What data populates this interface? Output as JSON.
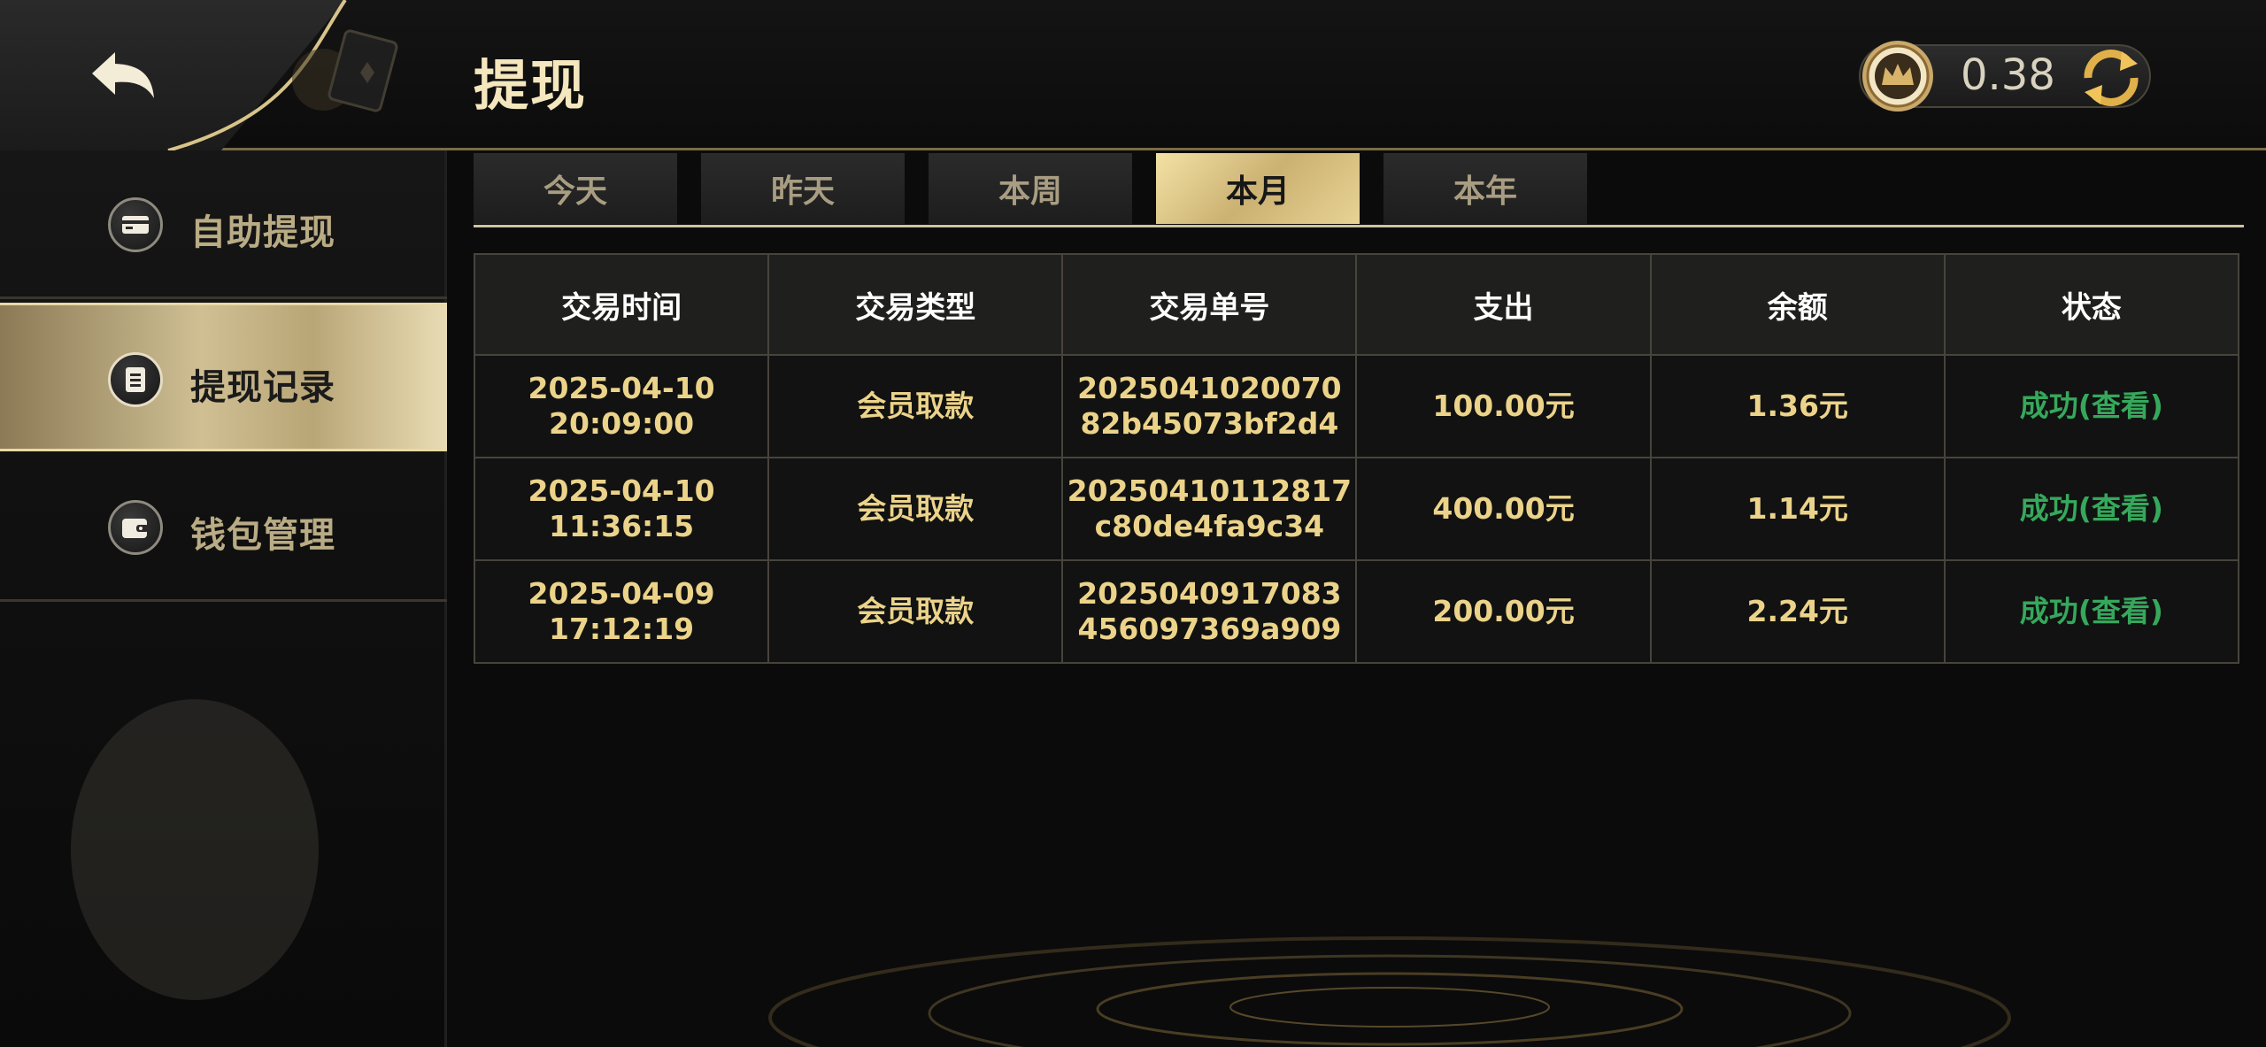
{
  "header": {
    "title": "提现",
    "balance": "0.38"
  },
  "sidebar": {
    "items": [
      {
        "label": "自助提现",
        "icon": "card-icon",
        "active": false
      },
      {
        "label": "提现记录",
        "icon": "record-icon",
        "active": true
      },
      {
        "label": "钱包管理",
        "icon": "wallet-icon",
        "active": false
      }
    ]
  },
  "tabs": [
    {
      "label": "今天",
      "active": false
    },
    {
      "label": "昨天",
      "active": false
    },
    {
      "label": "本周",
      "active": false
    },
    {
      "label": "本月",
      "active": true
    },
    {
      "label": "本年",
      "active": false
    }
  ],
  "table": {
    "columns": [
      "交易时间",
      "交易类型",
      "交易单号",
      "支出",
      "余额",
      "状态"
    ],
    "rows": [
      {
        "date": "2025-04-10",
        "time": "20:09:00",
        "type": "会员取款",
        "order_a": "2025041020070",
        "order_b": "82b45073bf2d4",
        "amount": "100.00元",
        "balance": "1.36元",
        "status": "成功(查看)"
      },
      {
        "date": "2025-04-10",
        "time": "11:36:15",
        "type": "会员取款",
        "order_a": "20250410112817",
        "order_b": "c80de4fa9c34",
        "amount": "400.00元",
        "balance": "1.14元",
        "status": "成功(查看)"
      },
      {
        "date": "2025-04-09",
        "time": "17:12:19",
        "type": "会员取款",
        "order_a": "2025040917083",
        "order_b": "456097369a909",
        "amount": "200.00元",
        "balance": "2.24元",
        "status": "成功(查看)"
      }
    ]
  },
  "colors": {
    "accent_gold": "#ecd38a",
    "status_success": "#36a85c",
    "active_tab": "#e8d394"
  }
}
